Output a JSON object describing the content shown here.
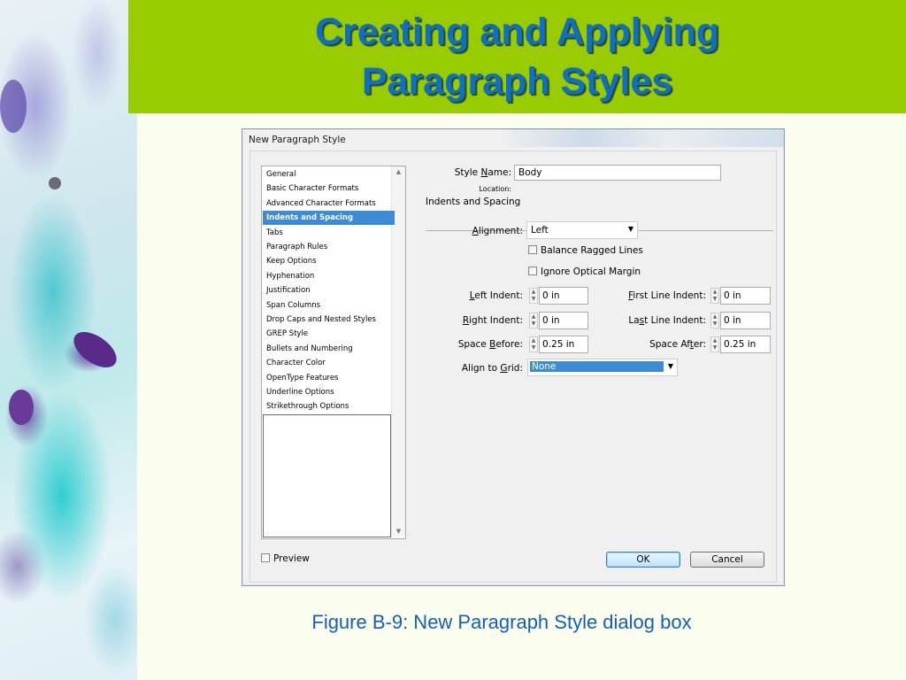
{
  "slide": {
    "title_line1": "Creating and Applying",
    "title_line2": "Paragraph Styles",
    "caption": "Figure B-9: New Paragraph Style dialog box"
  },
  "dialog": {
    "window_title": "New Paragraph Style",
    "categories": [
      "General",
      "Basic Character Formats",
      "Advanced Character Formats",
      "Indents and Spacing",
      "Tabs",
      "Paragraph Rules",
      "Keep Options",
      "Hyphenation",
      "Justification",
      "Span Columns",
      "Drop Caps and Nested Styles",
      "GREP Style",
      "Bullets and Numbering",
      "Character Color",
      "OpenType Features",
      "Underline Options",
      "Strikethrough Options"
    ],
    "selected_category": "Indents and Spacing",
    "style_name_label": "Style Name:",
    "style_name_value": "Body",
    "location_label": "Location:",
    "section_title": "Indents and Spacing",
    "alignment_label": "Alignment:",
    "alignment_value": "Left",
    "balance_ragged_lines": {
      "label": "Balance Ragged Lines",
      "checked": false
    },
    "ignore_optical_margin": {
      "label": "Ignore Optical Margin",
      "checked": false
    },
    "left_indent_label": "Left Indent:",
    "left_indent_value": "0 in",
    "first_line_indent_label": "First Line Indent:",
    "first_line_indent_value": "0 in",
    "right_indent_label": "Right Indent:",
    "right_indent_value": "0 in",
    "last_line_indent_label": "Last Line Indent:",
    "last_line_indent_value": "0 in",
    "space_before_label": "Space Before:",
    "space_before_value": "0.25 in",
    "space_after_label": "Space After:",
    "space_after_value": "0.25 in",
    "align_to_grid_label": "Align to Grid:",
    "align_to_grid_value": "None",
    "preview": {
      "label": "Preview",
      "checked": false
    },
    "ok_label": "OK",
    "cancel_label": "Cancel"
  },
  "colors": {
    "title_band": "#99cc00",
    "title_text": "#0f6fc6",
    "caption_text": "#1560b0",
    "selection": "#3d8bd4"
  }
}
